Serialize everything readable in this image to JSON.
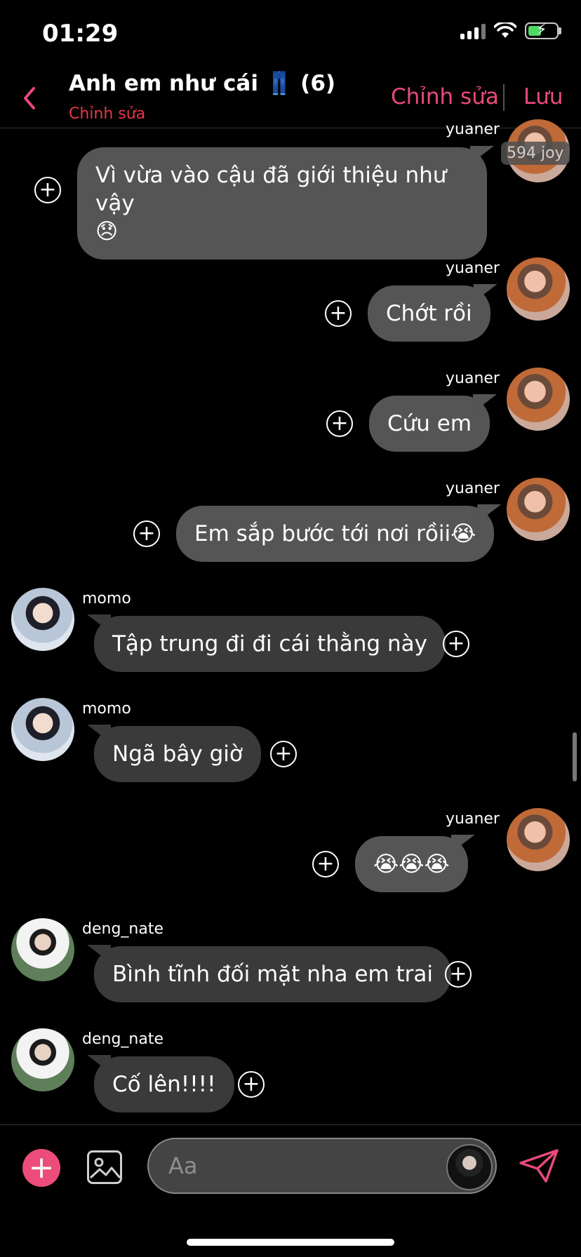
{
  "status_bar": {
    "time": "01:29"
  },
  "header": {
    "back_icon": "chevron-left-icon",
    "title": "Anh em như cái 👖 (6)",
    "subtitle": "Chỉnh sửa",
    "edit_label": "Chỉnh sửa",
    "save_label": "Lưu",
    "accent": "#e94a7a"
  },
  "badge": "594 joy",
  "messages": [
    {
      "sender": "yuaner",
      "text": "Vì vừa vào cậu đã giới thiệu như vậy",
      "text2": "😞"
    },
    {
      "sender": "yuaner",
      "text": "Chớt rồi"
    },
    {
      "sender": "yuaner",
      "text": "Cứu em"
    },
    {
      "sender": "yuaner",
      "text": "Em sắp bước tới nơi rồii😭"
    },
    {
      "sender": "momo",
      "text": "Tập trung đi đi cái thằng này"
    },
    {
      "sender": "momo",
      "text": "Ngã bây giờ"
    },
    {
      "sender": "yuaner",
      "text": "😭😭😭"
    },
    {
      "sender": "deng_nate",
      "text": "Bình tĩnh đối mặt nha em trai"
    },
    {
      "sender": "deng_nate",
      "text": "Cố lên!!!!"
    }
  ],
  "composer": {
    "placeholder": "Aa"
  },
  "colors": {
    "mine_bubble": "#555555",
    "other_bubble": "#3a3a3a",
    "plus_button": "#ec4c7a"
  }
}
